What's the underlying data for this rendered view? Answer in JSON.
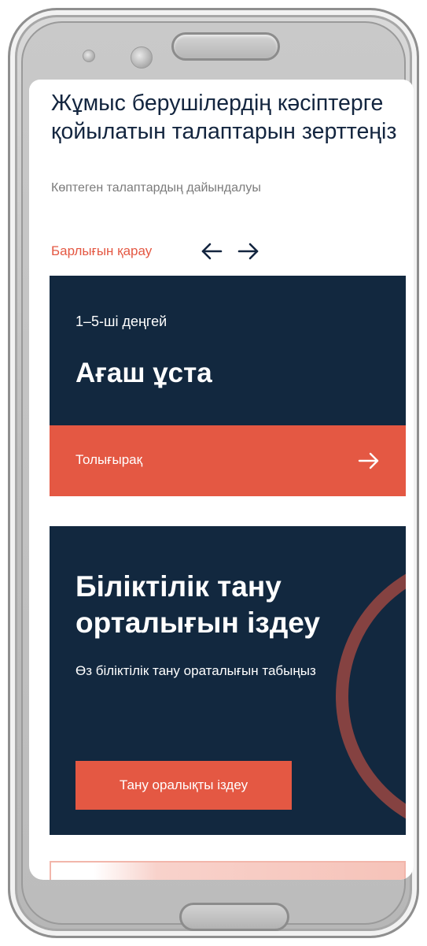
{
  "header": {
    "headline": "Жұмыс берушілердің кәсіптерге қойылатын талаптарын зерттеңіз",
    "subtext": "Көптеген талаптардың дайындалуы",
    "see_all_label": "Барлығын қарау",
    "prev_icon": "arrow-left-icon",
    "next_icon": "arrow-right-icon"
  },
  "level_card": {
    "level_label": "1–5-ші деңгей",
    "title": "Ағаш ұста",
    "more_label": "Толығырақ",
    "more_icon": "arrow-right-icon"
  },
  "center_card": {
    "title": "Біліктілік тану орталығын іздеу",
    "description": "Өз біліктілік тану ораталығын табыңыз",
    "button_label": "Тану оралықты іздеу"
  },
  "colors": {
    "navy": "#12283f",
    "accent": "#e45843",
    "headline": "#13253f",
    "muted": "#7b7b7b"
  }
}
